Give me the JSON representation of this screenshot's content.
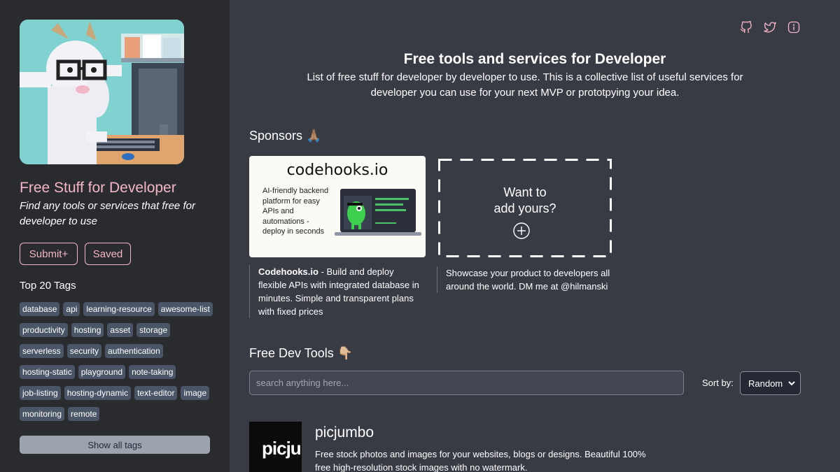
{
  "sidebar": {
    "title": "Free Stuff for Developer",
    "subtitle": "Find any tools or services that free for developer to use",
    "submit_label": "Submit+",
    "saved_label": "Saved",
    "tags_heading": "Top 20 Tags",
    "tags": [
      "database",
      "api",
      "learning-resource",
      "awesome-list",
      "productivity",
      "hosting",
      "asset",
      "storage",
      "serverless",
      "security",
      "authentication",
      "hosting-static",
      "playground",
      "note-taking",
      "job-listing",
      "hosting-dynamic",
      "text-editor",
      "image",
      "monitoring",
      "remote"
    ],
    "show_all_label": "Show all tags"
  },
  "header": {
    "icons": [
      "github-icon",
      "twitter-icon",
      "info-icon"
    ],
    "title": "Free tools and services for Developer",
    "description": "List of free stuff for developer by developer to use. This is a collective list of useful services for developer you can use for your next MVP or prototpying your idea."
  },
  "sponsors": {
    "heading": "Sponsors 🙏🏽",
    "card": {
      "name": "codehooks.io",
      "tagline": "AI-friendly backend platform for easy APIs and automations - deploy in seconds",
      "desc_bold": "Codehooks.io",
      "desc_rest": " - Build and deploy flexible APIs with integrated database in minutes. Simple and transparent plans with fixed prices"
    },
    "ad": {
      "line1": "Want to",
      "line2": "add yours?",
      "desc": "Showcase your product to developers all around the world. DM me at @hilmanski"
    }
  },
  "tools": {
    "heading": "Free Dev Tools 👇🏼",
    "search_placeholder": "search anything here...",
    "sort_label": "Sort by:",
    "sort_value": "Random",
    "items": [
      {
        "logo_text": "picju",
        "name": "picjumbo",
        "description": "Free stock photos and images for your websites, blogs or designs. Beautiful 100% free high-resolution stock images with no watermark."
      }
    ]
  },
  "colors": {
    "accent": "#f4b6c6",
    "sidebar_bg": "#2a2b2f",
    "main_bg": "#393b44",
    "tag_bg": "#4a5567"
  }
}
